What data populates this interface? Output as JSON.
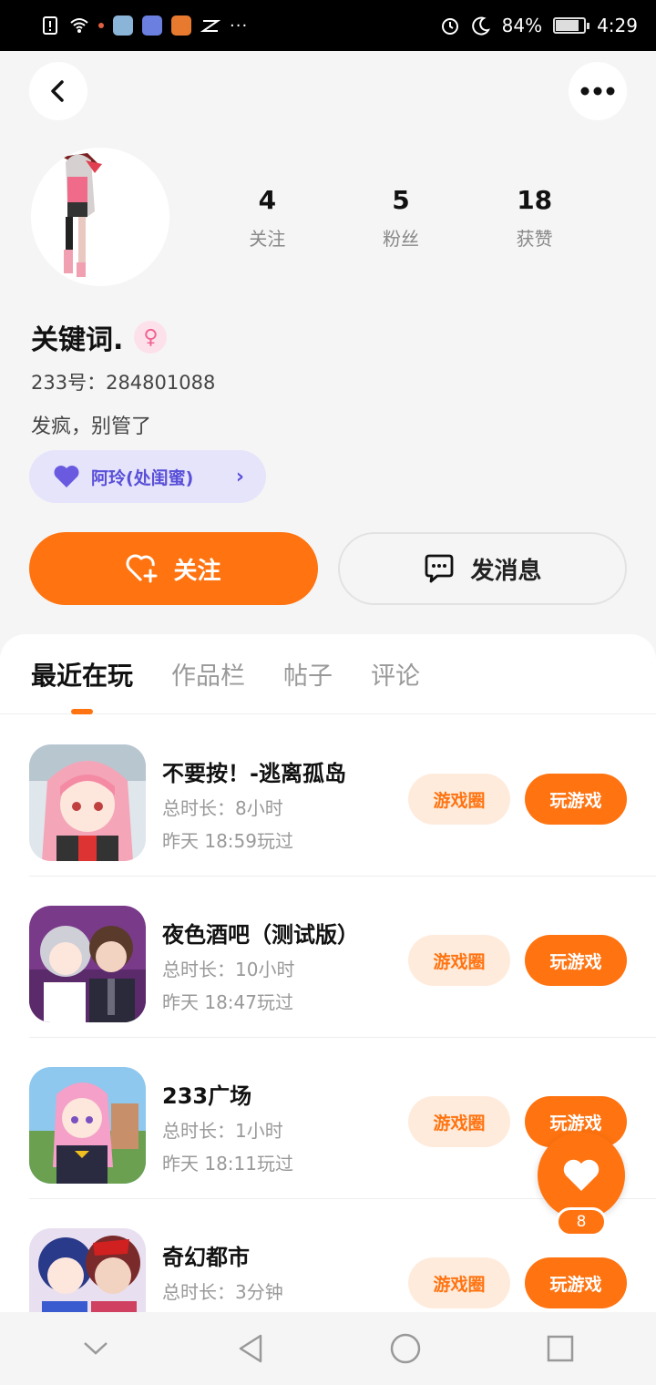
{
  "status_bar": {
    "battery": "84%",
    "battery_level": 0.84,
    "time": "4:29"
  },
  "profile": {
    "stats": [
      {
        "value": "4",
        "label": "关注"
      },
      {
        "value": "5",
        "label": "粉丝"
      },
      {
        "value": "18",
        "label": "获赞"
      }
    ],
    "nickname": "关键词.",
    "gender_icon": "female-icon",
    "user_id": "233号：284801088",
    "bio": "发疯，别管了",
    "relation_chip": "阿玲(处闺蜜)",
    "follow_label": "关注",
    "message_label": "发消息"
  },
  "tabs": [
    {
      "label": "最近在玩",
      "active": true
    },
    {
      "label": "作品栏",
      "active": false
    },
    {
      "label": "帖子",
      "active": false
    },
    {
      "label": "评论",
      "active": false
    }
  ],
  "games": [
    {
      "name": "不要按！-逃离孤岛",
      "duration": "总时长：8小时",
      "last_played": "昨天 18:59玩过",
      "circle_label": "游戏圈",
      "play_label": "玩游戏"
    },
    {
      "name": "夜色酒吧（测试版）",
      "duration": "总时长：10小时",
      "last_played": "昨天 18:47玩过",
      "circle_label": "游戏圈",
      "play_label": "玩游戏"
    },
    {
      "name": "233广场",
      "duration": "总时长：1小时",
      "last_played": "昨天 18:11玩过",
      "circle_label": "游戏圈",
      "play_label": "玩游戏"
    },
    {
      "name": "奇幻都市",
      "duration": "总时长：3分钟",
      "last_played": "",
      "circle_label": "游戏圈",
      "play_label": "玩游戏"
    }
  ],
  "float_like": {
    "count": "8"
  },
  "colors": {
    "accent": "#ff7310",
    "accent_light": "#ffebdc",
    "chip_bg": "#e6e4fb",
    "chip_text": "#5a50d8"
  }
}
